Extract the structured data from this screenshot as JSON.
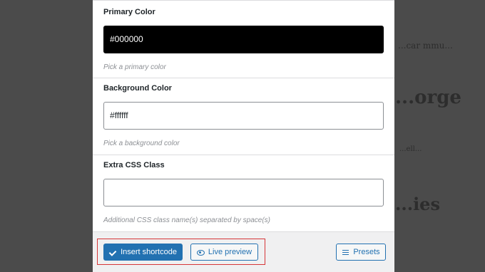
{
  "background": {
    "ghost_texts": [
      "...car mmu...",
      "...orge",
      "...ell...",
      "...ies"
    ]
  },
  "fields": [
    {
      "label": "Primary Color",
      "value": "#000000",
      "help": "Pick a primary color",
      "swatch": "#000000"
    },
    {
      "label": "Background Color",
      "value": "#ffffff",
      "help": "Pick a background color",
      "swatch": "#ffffff"
    },
    {
      "label": "Extra CSS Class",
      "value": "",
      "help": "Additional CSS class name(s) separated by space(s)"
    }
  ],
  "footer": {
    "insert_label": "Insert shortcode",
    "preview_label": "Live preview",
    "presets_label": "Presets"
  },
  "icons": {
    "insert": "check-icon",
    "preview": "eye-icon",
    "presets": "menu-icon"
  },
  "colors": {
    "accent": "#2271b1",
    "highlight": "#d63638"
  }
}
